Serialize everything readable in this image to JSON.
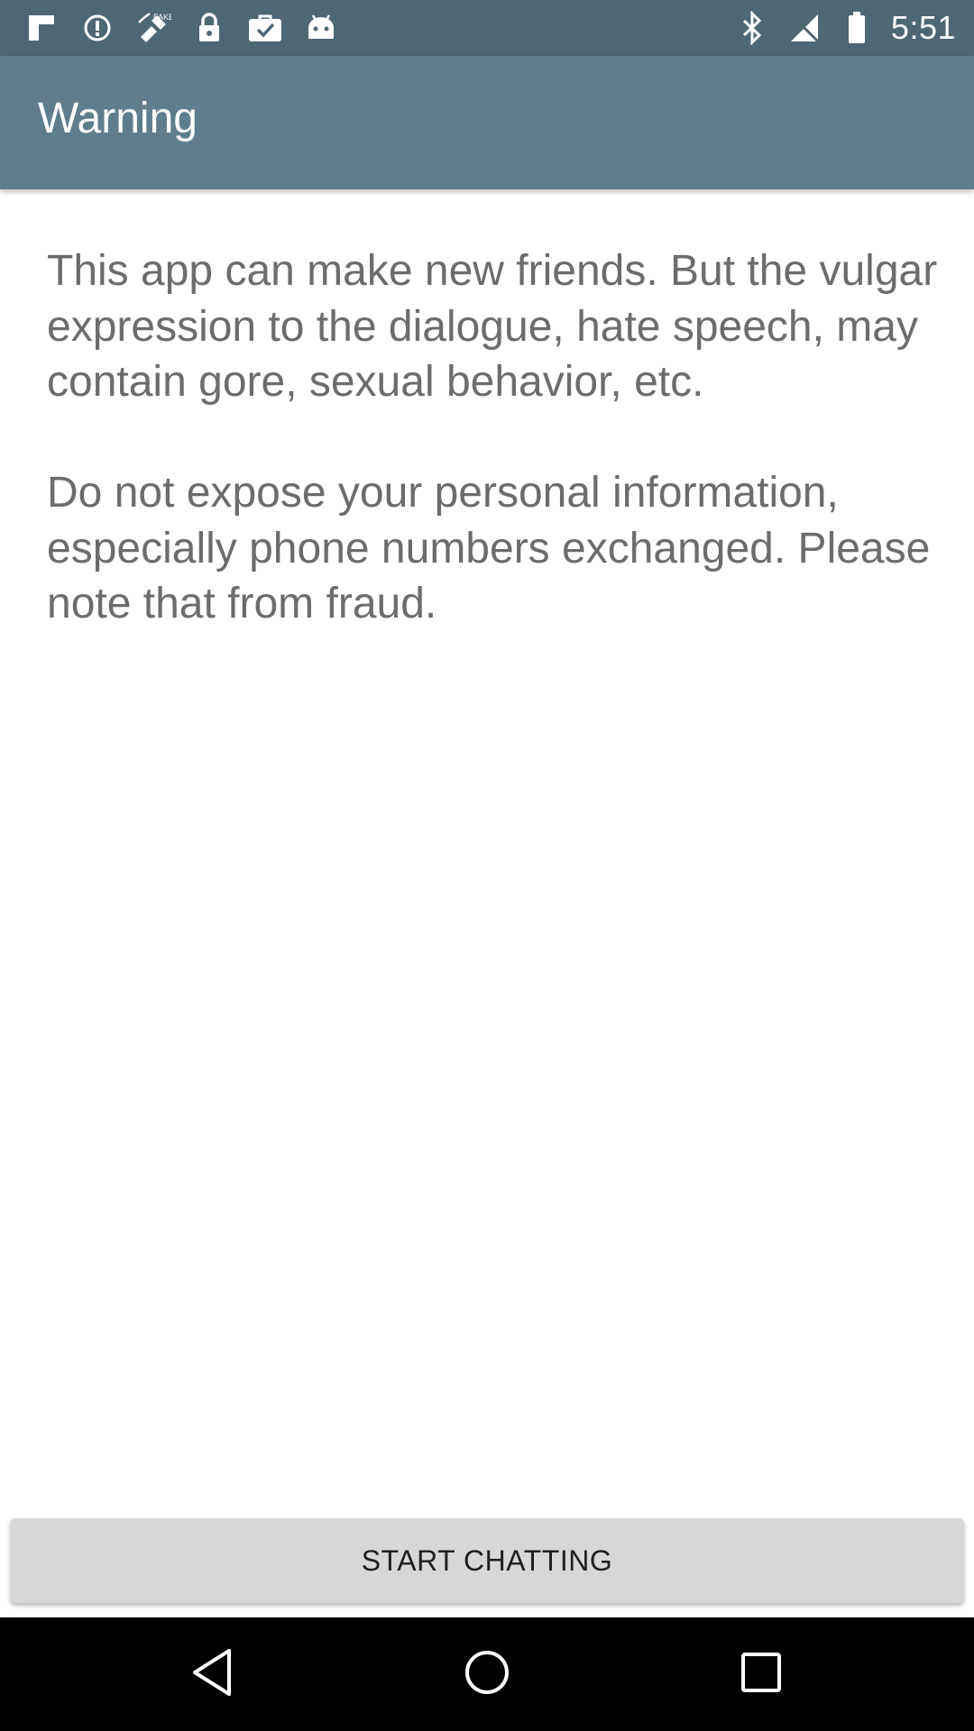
{
  "status_bar": {
    "time": "5:51",
    "left_icons": [
      "flipboard-icon",
      "data-saver-icon",
      "fake-gps-icon",
      "lock-icon",
      "briefcase-check-icon",
      "android-icon"
    ],
    "right_icons": [
      "bluetooth-icon",
      "signal-off-icon",
      "battery-icon"
    ]
  },
  "app_bar": {
    "title": "Warning"
  },
  "message": {
    "paragraph_1": "This app can make new friends. But the vulgar expression to the dialogue, hate speech, may contain gore, sexual behavior, etc.",
    "paragraph_2": "Do not expose your personal information, especially phone numbers exchanged. Please note that from fraud."
  },
  "actions": {
    "start_label": "START CHATTING"
  },
  "nav_bar": {
    "icons": [
      "back-icon",
      "home-icon",
      "recents-icon"
    ]
  },
  "colors": {
    "status_bar": "#4f6673",
    "app_bar": "#5f7d8b",
    "body_text": "#6c6c6c",
    "button_bg": "#d6d7d7"
  }
}
